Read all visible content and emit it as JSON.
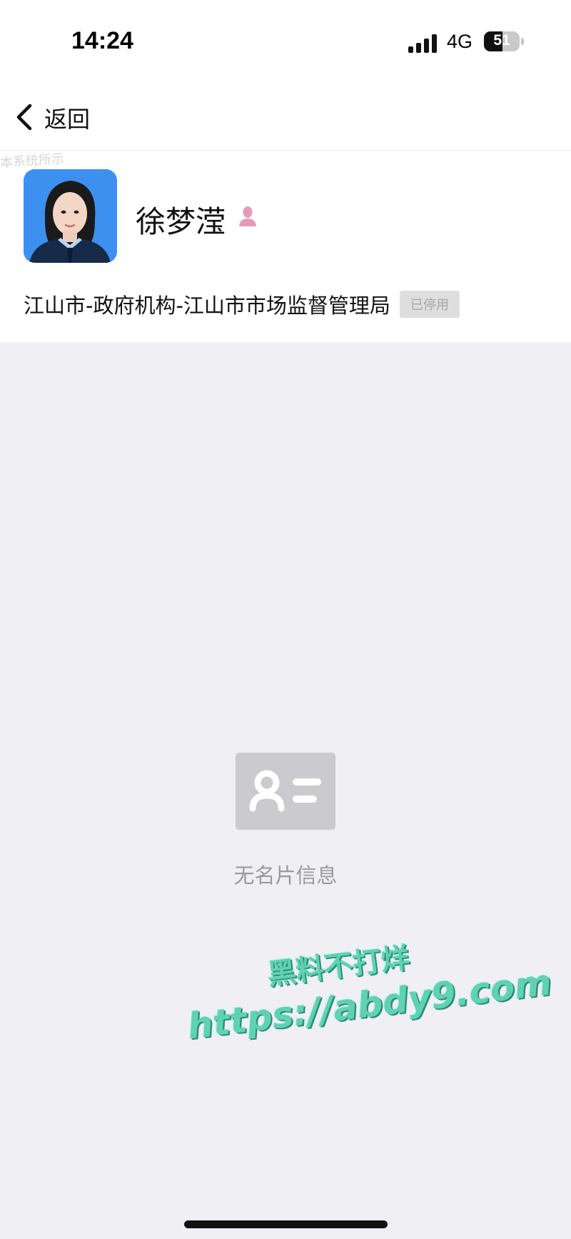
{
  "status_bar": {
    "time": "14:24",
    "network": "4G",
    "battery": "51",
    "battery_level": 0.51
  },
  "nav": {
    "back_label": "返回"
  },
  "profile": {
    "name": "徐梦滢",
    "gender_icon": "female-icon",
    "organization": "江山市-政府机构-江山市市场监督管理局",
    "status_badge": "已停用",
    "faint_watermark": "本系统所示"
  },
  "empty_state": {
    "icon": "contact-card-icon",
    "text": "无名片信息"
  },
  "watermark": {
    "line1": "黑料不打烊",
    "line2": "https://abdy9.com",
    "color": "#5fd2b2"
  },
  "colors": {
    "background": "#efeff4",
    "card": "#ffffff",
    "badge_bg": "#dedede",
    "badge_text": "#a8a8a8",
    "gender_icon": "#e59bb5",
    "avatar_bg": "#3d8ff0"
  }
}
